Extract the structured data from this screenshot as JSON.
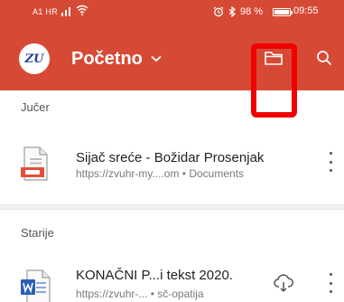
{
  "status_bar": {
    "carrier": "A1 HR",
    "battery": "98 %",
    "battery_level": 0.98,
    "time": "09:55"
  },
  "toolbar": {
    "avatar_text": "ZU",
    "title": "Početno",
    "icons": [
      "chevron-down-icon",
      "folder-icon",
      "search-icon"
    ]
  },
  "highlight_color": "#f00000",
  "accent_color": "#d64a35",
  "sections": [
    {
      "header": "Jučer",
      "files": [
        {
          "name": "Sijač sreće - Božidar Prosenjak",
          "meta": "https://zvuhr-my....om • Documents",
          "icon": "pdf-document-icon"
        }
      ]
    },
    {
      "header": "Starije",
      "files": [
        {
          "name": "KONAČNI  P...i tekst 2020.",
          "meta": "https://zvuhr-... • sč-opatija",
          "icon": "word-document-icon"
        }
      ]
    }
  ]
}
